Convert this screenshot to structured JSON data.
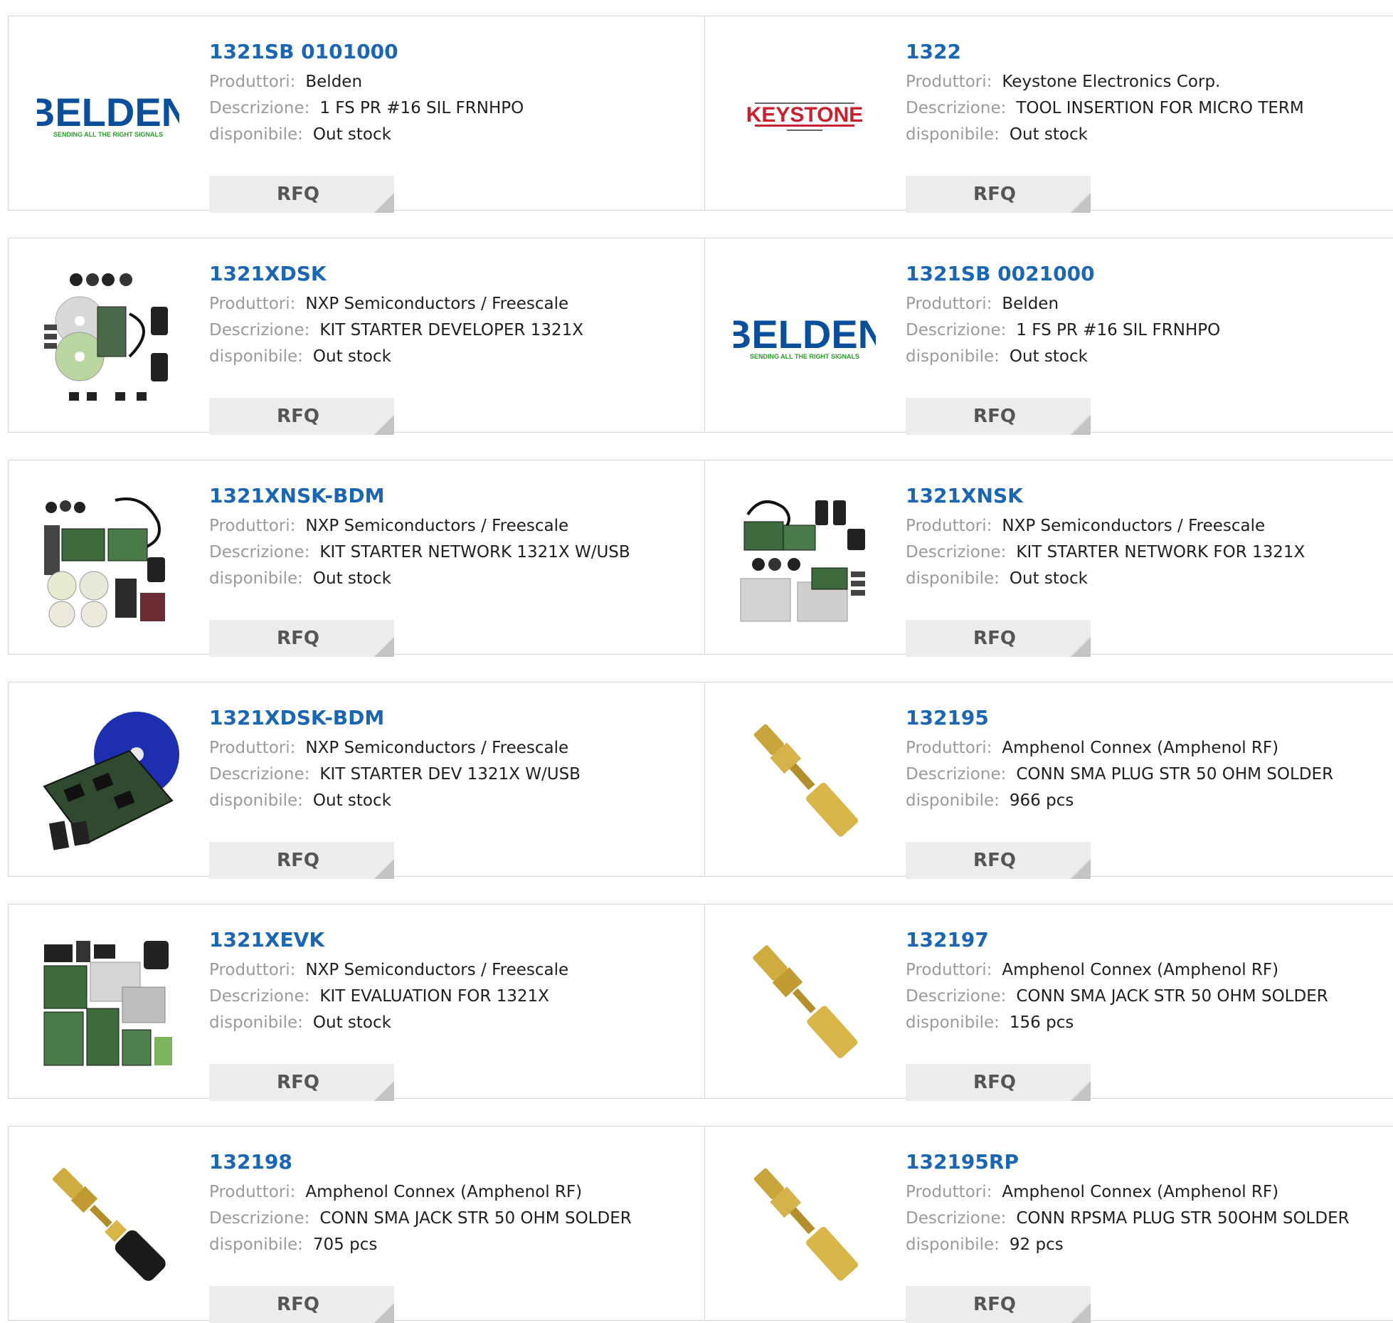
{
  "labels": {
    "manufacturer": "Produttori:",
    "description": "Descrizione:",
    "availability": "disponibile:",
    "rfq": "RFQ"
  },
  "colors": {
    "part_link": "#1a66b3",
    "label_gray": "#9a9a9a",
    "button_bg": "#ececec",
    "belden_blue": "#0a4f9c",
    "belden_green": "#2c9b2c",
    "keystone_red": "#c8202e"
  },
  "products": [
    {
      "part": "1321SB 0101000",
      "manufacturer": "Belden",
      "description": "1 FS PR #16 SIL FRNHPO",
      "availability": "Out stock",
      "image": "belden-logo",
      "logo_text": "BELDEN",
      "logo_tagline": "SENDING ALL THE RIGHT SIGNALS"
    },
    {
      "part": "1322",
      "manufacturer": "Keystone Electronics Corp.",
      "description": "TOOL INSERTION FOR MICRO TERM",
      "availability": "Out stock",
      "image": "keystone-logo",
      "logo_text": "KEYSTONE"
    },
    {
      "part": "1321XDSK",
      "manufacturer": "NXP Semiconductors / Freescale",
      "description": "KIT STARTER DEVELOPER 1321X",
      "availability": "Out stock",
      "image": "dev-kit-photo"
    },
    {
      "part": "1321SB 0021000",
      "manufacturer": "Belden",
      "description": "1 FS PR #16 SIL FRNHPO",
      "availability": "Out stock",
      "image": "belden-logo",
      "logo_text": "BELDEN",
      "logo_tagline": "SENDING ALL THE RIGHT SIGNALS"
    },
    {
      "part": "1321XNSK-BDM",
      "manufacturer": "NXP Semiconductors / Freescale",
      "description": "KIT STARTER NETWORK 1321X W/USB",
      "availability": "Out stock",
      "image": "network-kit-photo"
    },
    {
      "part": "1321XNSK",
      "manufacturer": "NXP Semiconductors / Freescale",
      "description": "KIT STARTER NETWORK FOR 1321X",
      "availability": "Out stock",
      "image": "network-kit-photo"
    },
    {
      "part": "1321XDSK-BDM",
      "manufacturer": "NXP Semiconductors / Freescale",
      "description": "KIT STARTER DEV 1321X W/USB",
      "availability": "Out stock",
      "image": "board-cd-photo"
    },
    {
      "part": "132195",
      "manufacturer": "Amphenol Connex (Amphenol RF)",
      "description": "CONN SMA PLUG STR 50 OHM SOLDER",
      "availability": "966 pcs",
      "image": "sma-connector-photo"
    },
    {
      "part": "1321XEVK",
      "manufacturer": "NXP Semiconductors / Freescale",
      "description": "KIT EVALUATION FOR 1321X",
      "availability": "Out stock",
      "image": "eval-kit-photo"
    },
    {
      "part": "132197",
      "manufacturer": "Amphenol Connex (Amphenol RF)",
      "description": "CONN SMA JACK STR 50 OHM SOLDER",
      "availability": "156 pcs",
      "image": "sma-connector-photo"
    },
    {
      "part": "132198",
      "manufacturer": "Amphenol Connex (Amphenol RF)",
      "description": "CONN SMA JACK STR 50 OHM SOLDER",
      "availability": "705 pcs",
      "image": "sma-jack-black-photo"
    },
    {
      "part": "132195RP",
      "manufacturer": "Amphenol Connex (Amphenol RF)",
      "description": "CONN RPSMA PLUG STR 50OHM SOLDER",
      "availability": "92 pcs",
      "image": "sma-connector-photo"
    }
  ]
}
